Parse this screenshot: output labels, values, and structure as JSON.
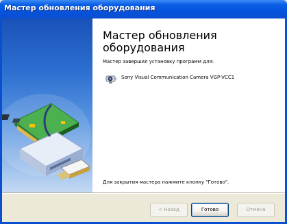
{
  "window": {
    "title": "Мастер обновления оборудования"
  },
  "content": {
    "heading": "Мастер обновления оборудования",
    "description": "Мастер завершил установку программ для:",
    "device_name": "Sony Visual Communication Camera VGP-VCC1",
    "device_icon": "camera-icon",
    "finish_text": "Для закрытия мастера нажмите кнопку \"Готово\"."
  },
  "buttons": {
    "back": "< Назад",
    "finish": "Готово",
    "cancel": "Отмена"
  },
  "colors": {
    "title_bar": "#0553dd",
    "panel_top": "#1a52b8",
    "panel_bottom": "#c4d9f3",
    "dialog_bg": "#ece9d8"
  }
}
